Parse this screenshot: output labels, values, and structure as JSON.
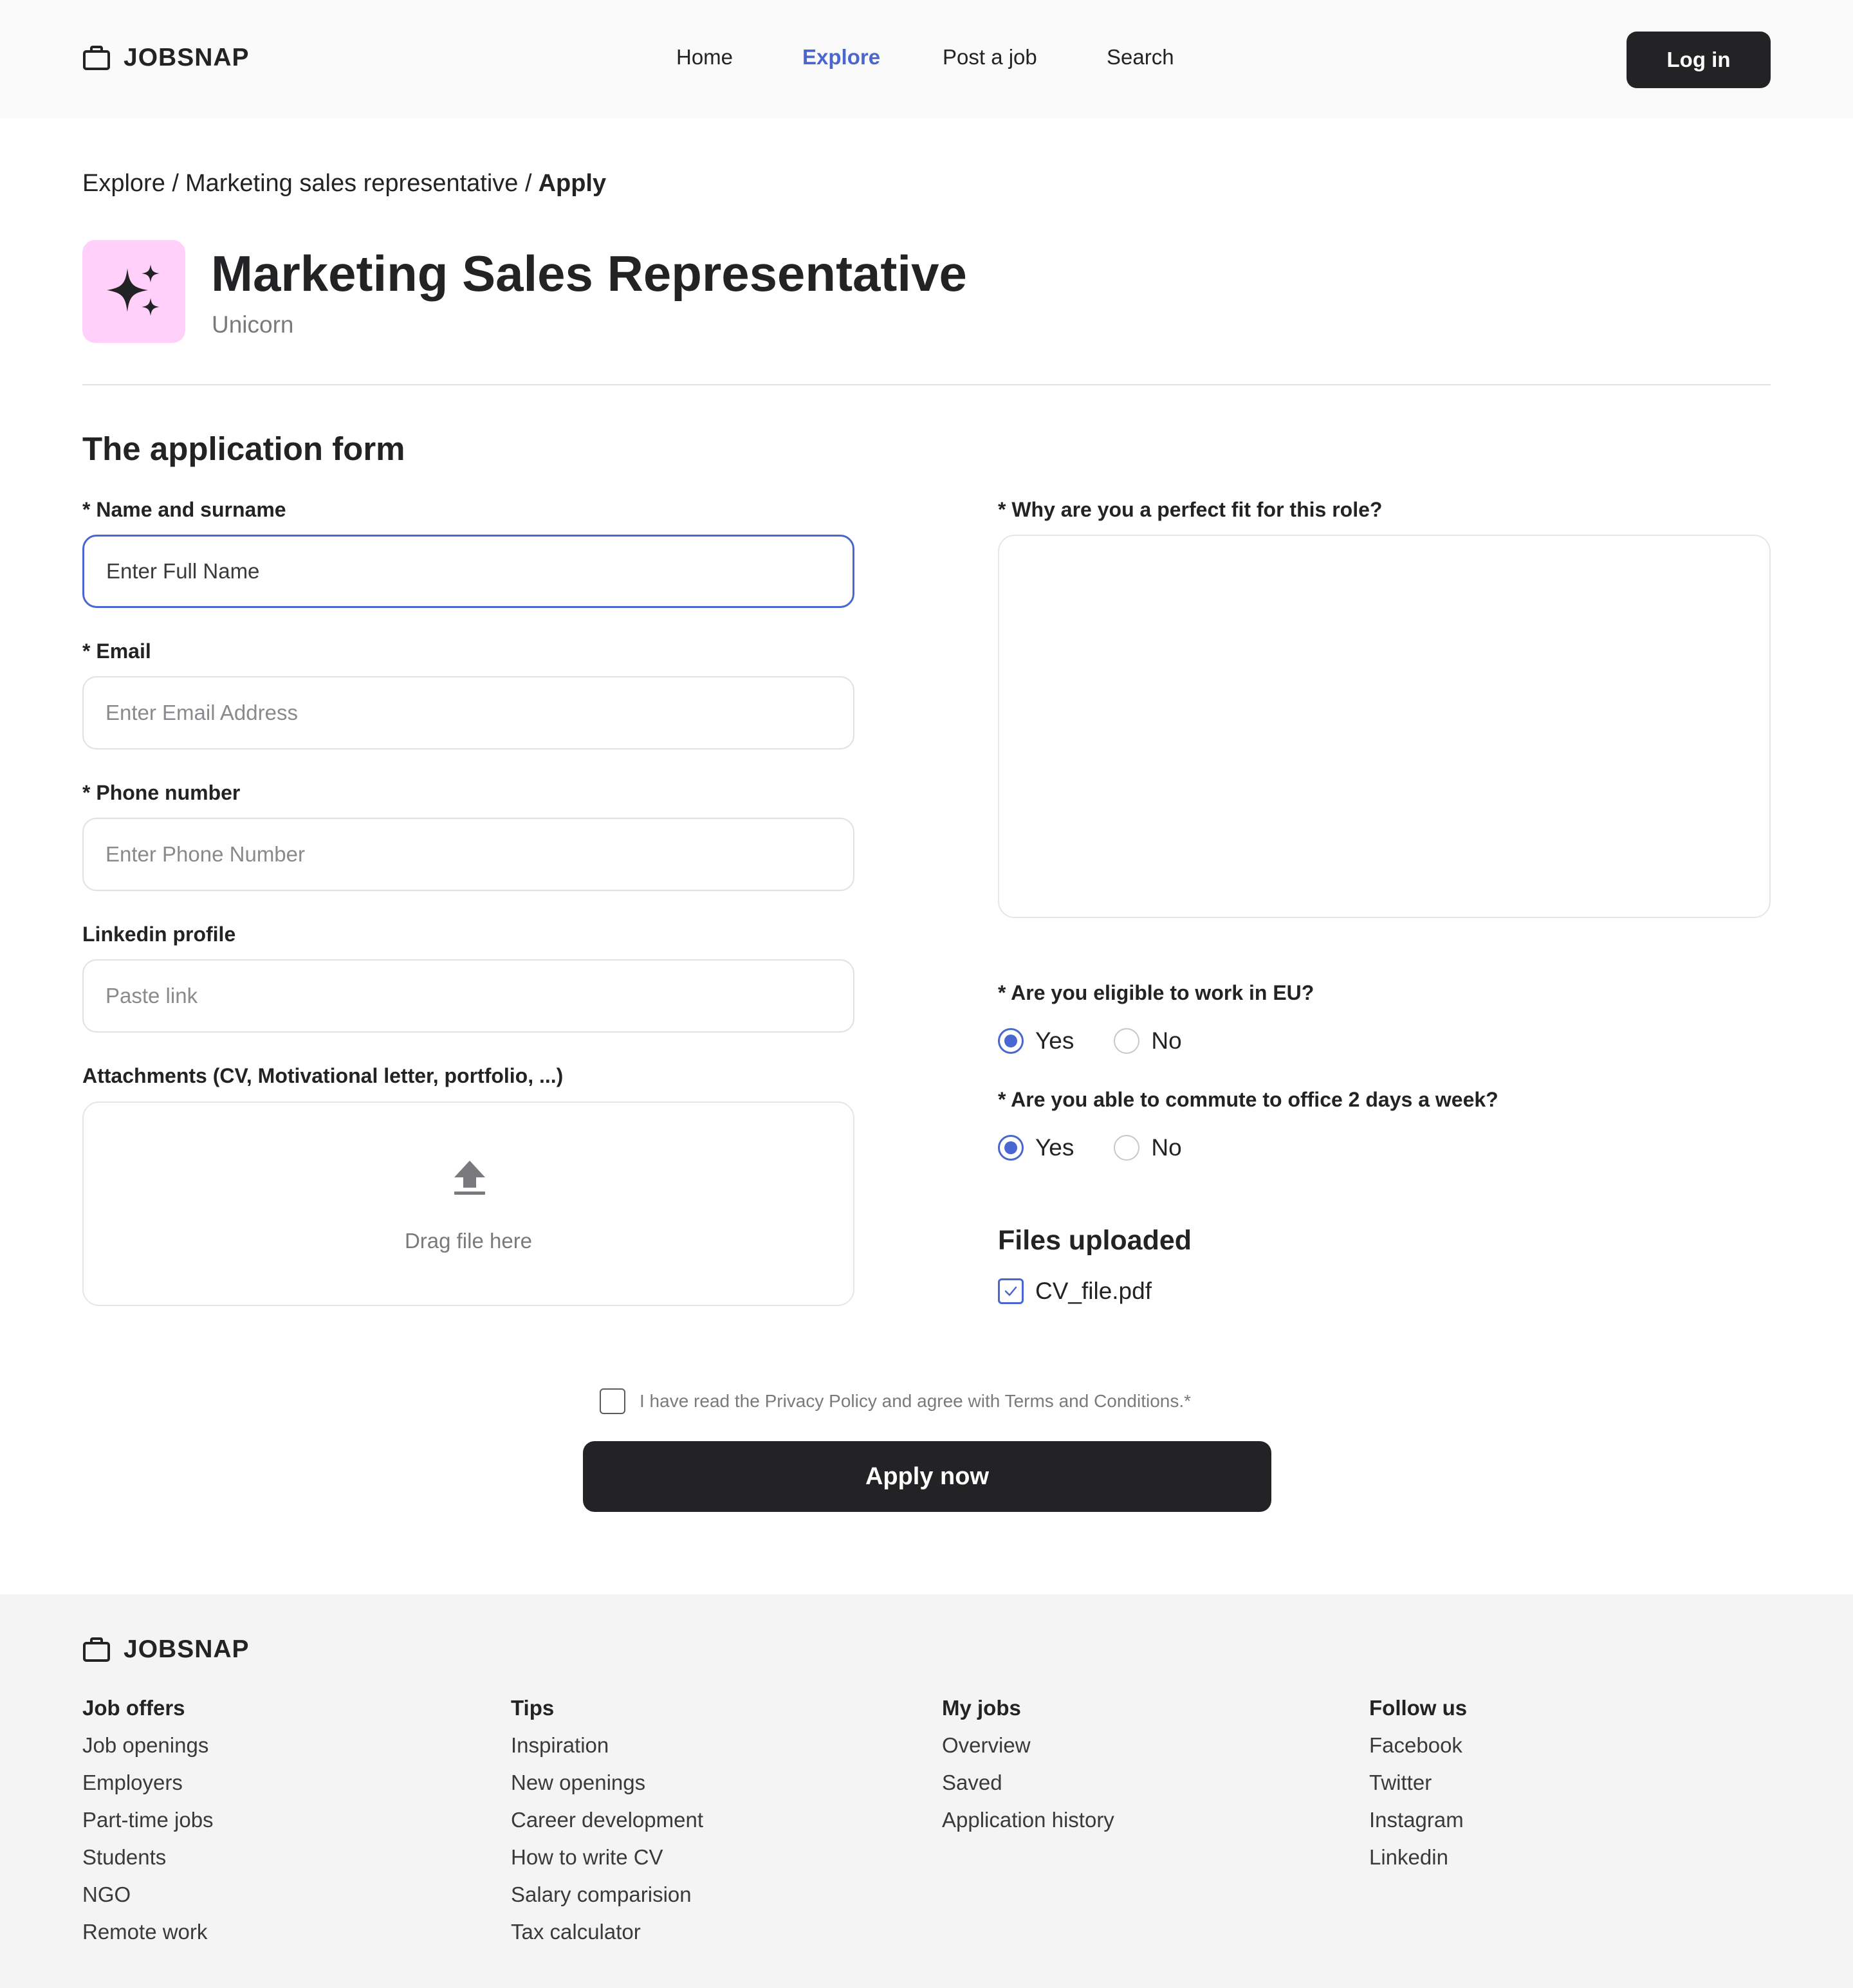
{
  "brand": {
    "name": "JOBSNAP",
    "icon": "briefcase-icon"
  },
  "nav": {
    "items": [
      {
        "label": "Home",
        "active": false
      },
      {
        "label": "Explore",
        "active": true
      },
      {
        "label": "Post a job",
        "active": false
      },
      {
        "label": "Search",
        "active": false
      }
    ],
    "login_label": "Log in"
  },
  "breadcrumb": {
    "items": [
      "Explore /",
      "Marketing sales representative /"
    ],
    "current": "Apply"
  },
  "job": {
    "title": "Marketing Sales Representative",
    "company": "Unicorn",
    "logo_icon": "sparkles-icon",
    "logo_bg": "#ffd1fa"
  },
  "form": {
    "title": "The application form",
    "name": {
      "label": "* Name and surname",
      "placeholder": "Enter Full Name",
      "value": ""
    },
    "email": {
      "label": "* Email",
      "placeholder": "Enter Email Address",
      "value": ""
    },
    "phone": {
      "label": "* Phone number",
      "placeholder": "Enter Phone Number",
      "value": ""
    },
    "linkedin": {
      "label": "Linkedin profile",
      "placeholder": "Paste link",
      "value": ""
    },
    "attachments": {
      "label": "Attachments (CV, Motivational letter, portfolio, ...)",
      "drop_text": "Drag file here",
      "icon": "upload-icon"
    },
    "fit": {
      "label": "* Why are you a perfect fit for this role?",
      "value": ""
    },
    "eligible": {
      "label": "* Are you eligible to work in EU?",
      "options": [
        "Yes",
        "No"
      ],
      "selected": "Yes"
    },
    "commute": {
      "label": "* Are you able to commute to office 2 days a week?",
      "options": [
        "Yes",
        "No"
      ],
      "selected": "Yes"
    },
    "files": {
      "title": "Files uploaded",
      "items": [
        {
          "name": "CV_file.pdf",
          "checked": true
        }
      ]
    },
    "agree": {
      "text": "I have read the Privacy Policy and agree with Terms and Conditions.*",
      "checked": false
    },
    "submit_label": "Apply now"
  },
  "footer": {
    "columns": [
      {
        "title": "Job offers",
        "links": [
          "Job openings",
          "Employers",
          "Part-time jobs",
          "Students",
          "NGO",
          "Remote work"
        ]
      },
      {
        "title": "Tips",
        "links": [
          "Inspiration",
          "New openings",
          "Career development",
          "How to write CV",
          "Salary comparision",
          "Tax calculator"
        ]
      },
      {
        "title": "My jobs",
        "links": [
          "Overview",
          "Saved",
          "Application history"
        ]
      },
      {
        "title": "Follow us",
        "links": [
          "Facebook",
          "Twitter",
          "Instagram",
          "Linkedin"
        ]
      }
    ]
  },
  "colors": {
    "accent": "#4a66d0",
    "dark": "#232325",
    "footer_bg": "#f4f4f4",
    "header_bg": "#fafafa"
  }
}
